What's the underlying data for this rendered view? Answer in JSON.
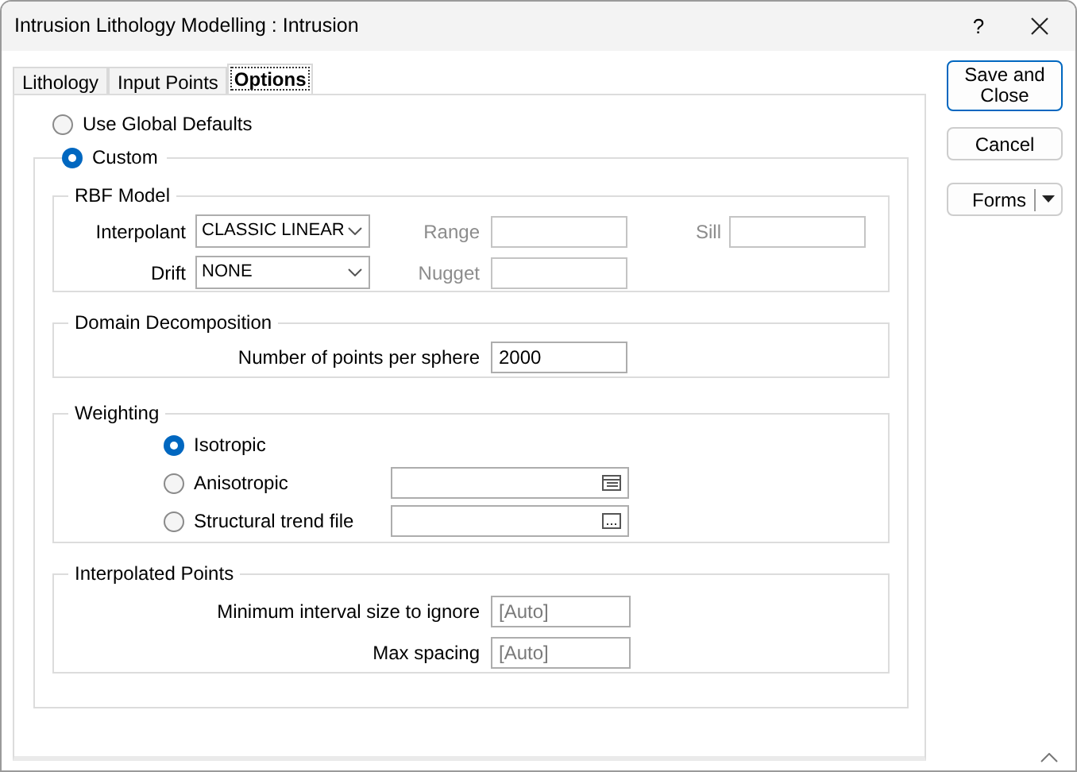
{
  "window": {
    "title": "Intrusion Lithology Modelling : Intrusion",
    "help": "?"
  },
  "tabs": [
    {
      "label": "Lithology",
      "selected": false
    },
    {
      "label": "Input Points",
      "selected": false
    },
    {
      "label": "Options",
      "selected": true
    }
  ],
  "mode": [
    {
      "label": "Use Global Defaults",
      "selected": false
    },
    {
      "label": "Custom",
      "selected": true
    }
  ],
  "rbf_model": {
    "title": "RBF Model",
    "interpolant": {
      "label": "Interpolant",
      "value": "CLASSIC LINEAR",
      "disabled": false
    },
    "drift": {
      "label": "Drift",
      "value": "NONE",
      "disabled": false
    },
    "range": {
      "label": "Range",
      "disabled": true
    },
    "nugget": {
      "label": "Nugget",
      "disabled": true
    },
    "sill": {
      "label": "Sill",
      "disabled": true
    }
  },
  "domain_decomposition": {
    "title": "Domain Decomposition",
    "label": "Number of points per sphere",
    "value": "2000"
  },
  "weighting": {
    "title": "Weighting",
    "options": [
      {
        "label": "Isotropic",
        "selected": true,
        "kind": "plain"
      },
      {
        "label": "Anisotropic",
        "selected": false,
        "kind": "table-picker"
      },
      {
        "label": "Structural trend file",
        "selected": false,
        "kind": "file-picker"
      }
    ]
  },
  "interpolated_points": {
    "title": "Interpolated Points",
    "fields": [
      {
        "label": "Minimum interval size to ignore",
        "placeholder": "[Auto]"
      },
      {
        "label": "Max spacing",
        "placeholder": "[Auto]"
      }
    ]
  },
  "buttons": [
    {
      "label": "Save and Close",
      "kind": "default"
    },
    {
      "label": "Cancel",
      "kind": "plain"
    },
    {
      "label": "Forms",
      "kind": "split"
    }
  ]
}
